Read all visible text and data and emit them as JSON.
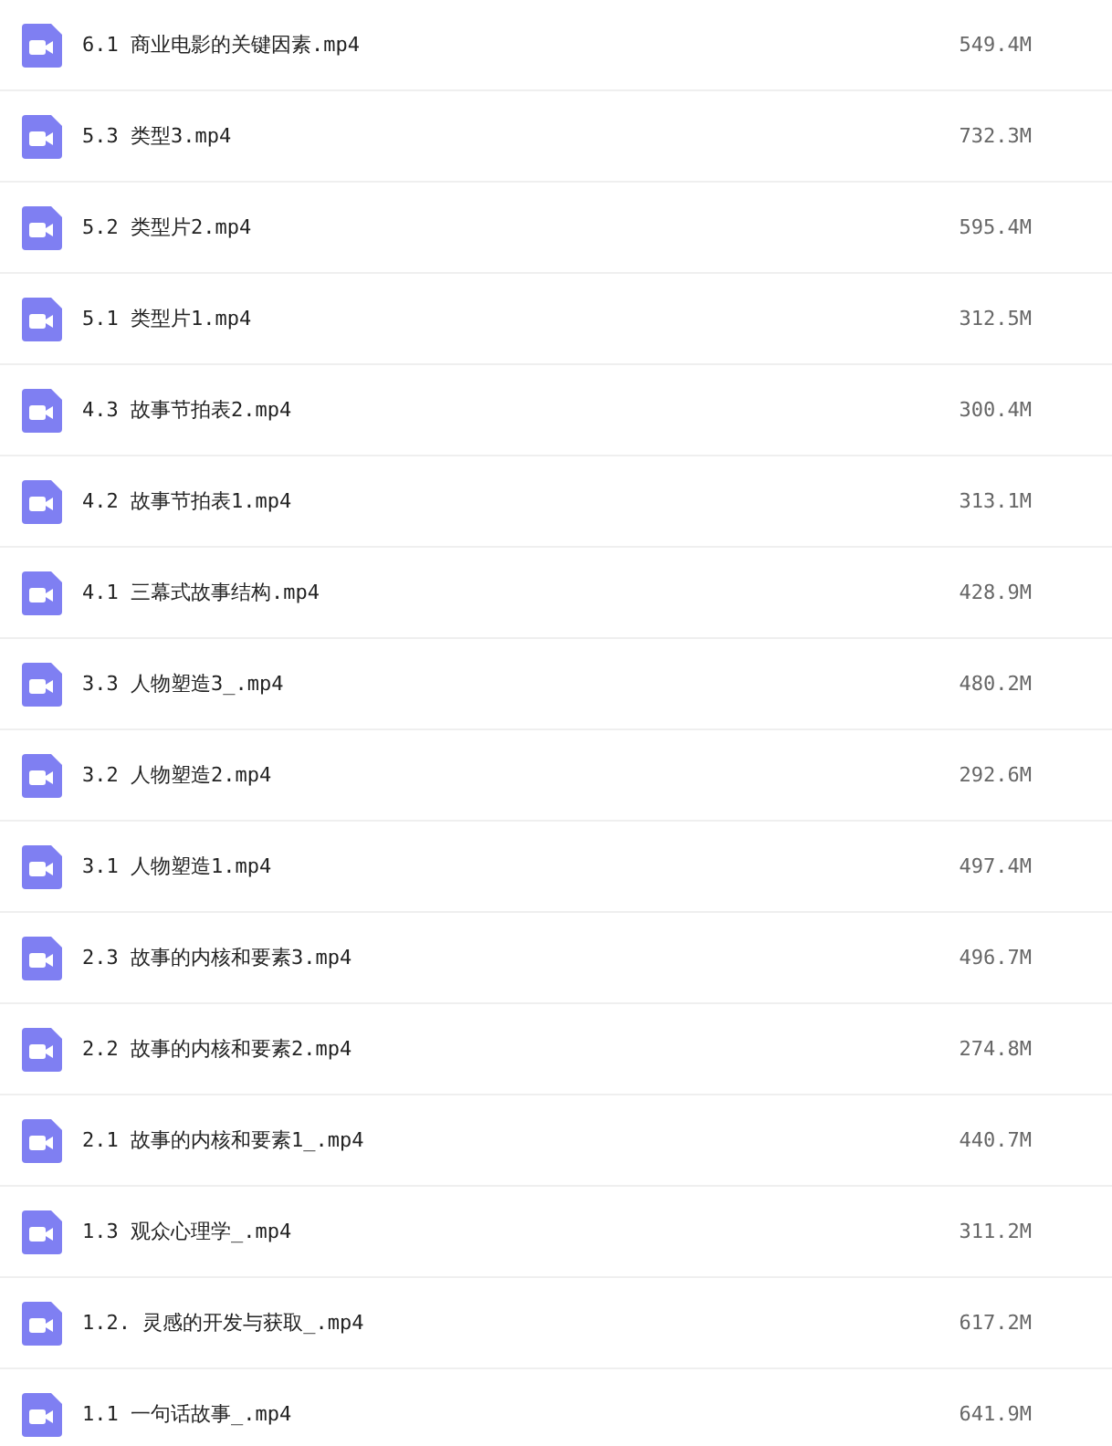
{
  "files": [
    {
      "name": "6.1 商业电影的关键因素.mp4",
      "size": "549.4M"
    },
    {
      "name": "5.3 类型3.mp4",
      "size": "732.3M"
    },
    {
      "name": "5.2 类型片2.mp4",
      "size": "595.4M"
    },
    {
      "name": "5.1 类型片1.mp4",
      "size": "312.5M"
    },
    {
      "name": "4.3 故事节拍表2.mp4",
      "size": "300.4M"
    },
    {
      "name": "4.2 故事节拍表1.mp4",
      "size": "313.1M"
    },
    {
      "name": "4.1 三幕式故事结构.mp4",
      "size": "428.9M"
    },
    {
      "name": "3.3 人物塑造3_.mp4",
      "size": "480.2M"
    },
    {
      "name": "3.2 人物塑造2.mp4",
      "size": "292.6M"
    },
    {
      "name": "3.1 人物塑造1.mp4",
      "size": "497.4M"
    },
    {
      "name": "2.3 故事的内核和要素3.mp4",
      "size": "496.7M"
    },
    {
      "name": "2.2 故事的内核和要素2.mp4",
      "size": "274.8M"
    },
    {
      "name": "2.1 故事的内核和要素1_.mp4",
      "size": "440.7M"
    },
    {
      "name": "1.3 观众心理学_.mp4",
      "size": "311.2M"
    },
    {
      "name": "1.2. 灵感的开发与获取_.mp4",
      "size": "617.2M"
    },
    {
      "name": "1.1 一句话故事_.mp4",
      "size": "641.9M"
    }
  ]
}
